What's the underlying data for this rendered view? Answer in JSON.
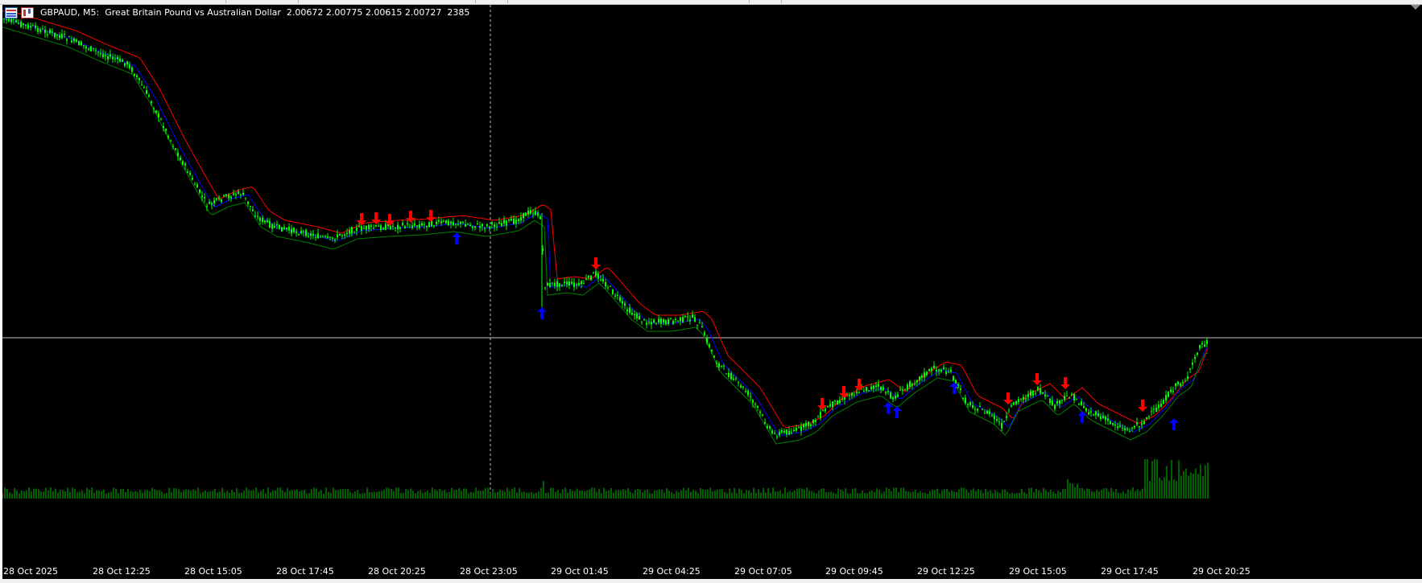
{
  "header": {
    "symbol": "GBPAUD, M5:",
    "description": "Great Britain Pound vs Australian Dollar",
    "ohlc": "2.00672 2.00775 2.00615 2.00727",
    "bars": "2385"
  },
  "time_axis": {
    "labels": [
      "28 Oct 2025",
      "28 Oct 12:25",
      "28 Oct 15:05",
      "28 Oct 17:45",
      "28 Oct 20:25",
      "28 Oct 23:05",
      "29 Oct 01:45",
      "29 Oct 04:25",
      "29 Oct 07:05",
      "29 Oct 09:45",
      "29 Oct 12:25",
      "29 Oct 15:05",
      "29 Oct 17:45",
      "29 Oct 20:25"
    ]
  },
  "colors": {
    "background": "#000000",
    "candle": "#00ff00",
    "upper_band": "#ff0000",
    "middle_band": "#0000ff",
    "lower_band": "#008000",
    "sell_arrow": "#ff0000",
    "buy_arrow": "#0000ff",
    "volume": "#00c000",
    "crosshair": "#c0c0c0"
  },
  "icons": {
    "window": "chart-window-icon",
    "chart": "candle-chart-icon"
  }
}
